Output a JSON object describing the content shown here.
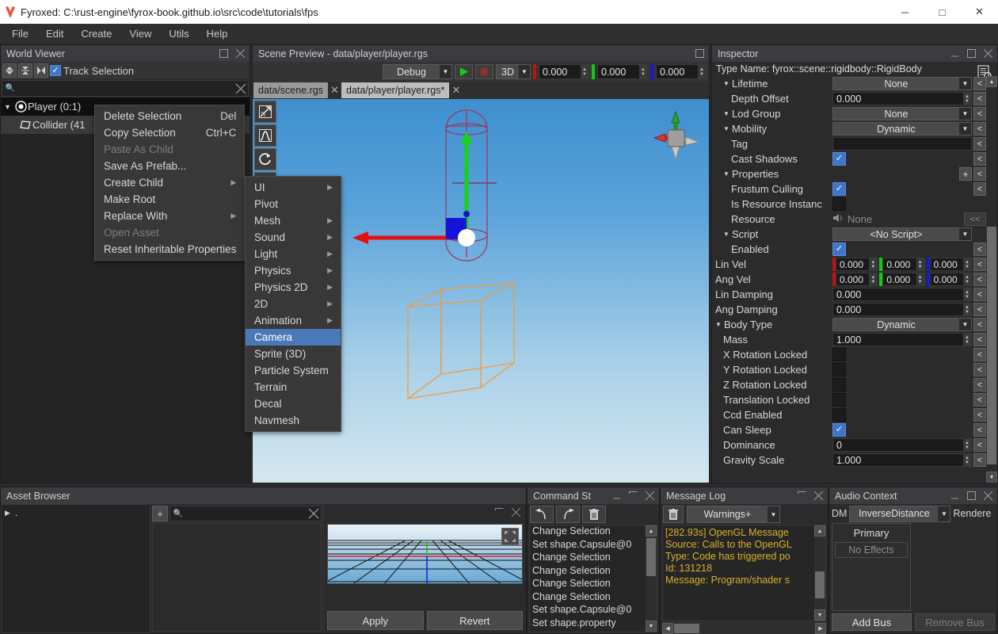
{
  "window": {
    "title": "Fyroxed: C:\\rust-engine\\fyrox-book.github.io\\src\\code\\tutorials\\fps",
    "app_icon": "fyrox-logo-icon",
    "minimize": "─",
    "maximize": "□",
    "close": "✕"
  },
  "menubar": {
    "items": [
      "File",
      "Edit",
      "Create",
      "View",
      "Utils",
      "Help"
    ]
  },
  "world_viewer": {
    "title": "World Viewer",
    "toolbar": {
      "collapse_all_icon": "collapse-all-icon",
      "expand_all_icon": "expand-all-icon",
      "locate_selection_icon": "locate-selection-icon",
      "track_selection_label": "Track Selection",
      "track_selection_checked": true
    },
    "search": {
      "placeholder": "",
      "value": "",
      "icon": "search-icon",
      "clear_icon": "clear-icon"
    },
    "tree": [
      {
        "label": "Player (0:1)",
        "icon": "rigidbody-node-icon",
        "expanded": true,
        "selected": true,
        "depth": 0
      },
      {
        "label": "Collider (41",
        "icon": "collider-node-icon",
        "expanded": false,
        "selected": true,
        "depth": 1
      }
    ]
  },
  "context_menu": {
    "items": [
      {
        "label": "Delete Selection",
        "shortcut": "Del",
        "disabled": false,
        "submenu": false
      },
      {
        "label": "Copy Selection",
        "shortcut": "Ctrl+C",
        "disabled": false,
        "submenu": false
      },
      {
        "label": "Paste As Child",
        "shortcut": "",
        "disabled": true,
        "submenu": false
      },
      {
        "label": "Save As Prefab...",
        "shortcut": "",
        "disabled": false,
        "submenu": false
      },
      {
        "label": "Create Child",
        "shortcut": "",
        "disabled": false,
        "submenu": true
      },
      {
        "label": "Make Root",
        "shortcut": "",
        "disabled": false,
        "submenu": false
      },
      {
        "label": "Replace With",
        "shortcut": "",
        "disabled": false,
        "submenu": true
      },
      {
        "label": "Open Asset",
        "shortcut": "",
        "disabled": true,
        "submenu": false
      },
      {
        "label": "Reset Inheritable Properties",
        "shortcut": "",
        "disabled": false,
        "submenu": false
      }
    ]
  },
  "create_child_submenu": {
    "highlight_color": "#4a79b8",
    "items": [
      {
        "label": "UI",
        "submenu": true,
        "highlighted": false
      },
      {
        "label": "Pivot",
        "submenu": false,
        "highlighted": false
      },
      {
        "label": "Mesh",
        "submenu": true,
        "highlighted": false
      },
      {
        "label": "Sound",
        "submenu": true,
        "highlighted": false
      },
      {
        "label": "Light",
        "submenu": true,
        "highlighted": false
      },
      {
        "label": "Physics",
        "submenu": true,
        "highlighted": false
      },
      {
        "label": "Physics 2D",
        "submenu": true,
        "highlighted": false
      },
      {
        "label": "2D",
        "submenu": true,
        "highlighted": false
      },
      {
        "label": "Animation",
        "submenu": true,
        "highlighted": false
      },
      {
        "label": "Camera",
        "submenu": false,
        "highlighted": true
      },
      {
        "label": "Sprite (3D)",
        "submenu": false,
        "highlighted": false
      },
      {
        "label": "Particle System",
        "submenu": false,
        "highlighted": false
      },
      {
        "label": "Terrain",
        "submenu": false,
        "highlighted": false
      },
      {
        "label": "Decal",
        "submenu": false,
        "highlighted": false
      },
      {
        "label": "Navmesh",
        "submenu": false,
        "highlighted": false
      }
    ]
  },
  "scene_preview": {
    "title": "Scene Preview - data/player/player.rgs",
    "maximize_icon": "maximize-icon",
    "toolbar": {
      "mode_value": "Debug",
      "play_icon": "play-icon",
      "stop_icon": "stop-icon",
      "dimension_value": "3D",
      "x_value": "0.000",
      "y_value": "0.000",
      "z_value": "0.000",
      "x_color": "#c31010",
      "y_color": "#13c913",
      "z_color": "#1818cf"
    },
    "tabs": [
      {
        "label": "data/scene.rgs",
        "active": false
      },
      {
        "label": "data/player/player.rgs*",
        "active": true
      }
    ],
    "viewport_tools": [
      {
        "icon": "move-tool-icon",
        "name": "select-move-tool"
      },
      {
        "icon": "scale-tool-icon",
        "name": "scale-tool"
      },
      {
        "icon": "rotate-tool-icon",
        "name": "rotate-tool"
      },
      {
        "icon": "navmesh-tool-icon",
        "name": "navmesh-tool"
      }
    ],
    "orientation_gizmo": "axis-orientation-gizmo"
  },
  "inspector": {
    "title": "Inspector",
    "minimize_icon": "minimize-icon",
    "maximize_icon": "maximize-icon",
    "close_icon": "close-icon",
    "doc_icon": "documentation-icon",
    "type_name": "Type Name: fyrox::scene::rigidbody::RigidBody",
    "revert_label": "<",
    "revert_wide_label": "<<",
    "add_label": "+",
    "rows": [
      {
        "label": "Lifetime",
        "kind": "dropdown",
        "value": "None",
        "expander": true,
        "indent": 1
      },
      {
        "label": "Depth Offset",
        "kind": "number",
        "value": "0.000",
        "expander": false,
        "indent": 2
      },
      {
        "label": "Lod Group",
        "kind": "dropdown",
        "value": "None",
        "expander": true,
        "indent": 1
      },
      {
        "label": "Mobility",
        "kind": "dropdown",
        "value": "Dynamic",
        "expander": true,
        "indent": 1
      },
      {
        "label": "Tag",
        "kind": "text",
        "value": "",
        "expander": false,
        "indent": 2
      },
      {
        "label": "Cast Shadows",
        "kind": "checkbox",
        "value": true,
        "expander": false,
        "indent": 2
      },
      {
        "label": "Properties",
        "kind": "addrow",
        "value": "",
        "expander": true,
        "indent": 1
      },
      {
        "label": "Frustum Culling",
        "kind": "checkbox",
        "value": true,
        "expander": false,
        "indent": 2
      },
      {
        "label": "Is Resource Instanc",
        "kind": "checkbox",
        "value": false,
        "expander": false,
        "indent": 2,
        "no_revert": true
      },
      {
        "label": "Resource",
        "kind": "resource",
        "value": "None",
        "expander": false,
        "indent": 2
      },
      {
        "label": "Script",
        "kind": "dropdown",
        "value": "<No Script>",
        "expander": true,
        "indent": 1,
        "no_revert": true
      },
      {
        "label": "Enabled",
        "kind": "checkbox",
        "value": true,
        "expander": false,
        "indent": 2
      },
      {
        "label": "Lin Vel",
        "kind": "vec3",
        "value": [
          "0.000",
          "0.000",
          "0.000"
        ],
        "expander": false,
        "indent": 0
      },
      {
        "label": "Ang Vel",
        "kind": "vec3",
        "value": [
          "0.000",
          "0.000",
          "0.000"
        ],
        "expander": false,
        "indent": 0
      },
      {
        "label": "Lin Damping",
        "kind": "number",
        "value": "0.000",
        "expander": false,
        "indent": 0
      },
      {
        "label": "Ang Damping",
        "kind": "number",
        "value": "0.000",
        "expander": false,
        "indent": 0
      },
      {
        "label": "Body Type",
        "kind": "dropdown",
        "value": "Dynamic",
        "expander": true,
        "indent": 0
      },
      {
        "label": "Mass",
        "kind": "number",
        "value": "1.000",
        "expander": false,
        "indent": 1
      },
      {
        "label": "X Rotation Locked",
        "kind": "checkbox",
        "value": false,
        "expander": false,
        "indent": 1
      },
      {
        "label": "Y Rotation Locked",
        "kind": "checkbox",
        "value": false,
        "expander": false,
        "indent": 1
      },
      {
        "label": "Z Rotation Locked",
        "kind": "checkbox",
        "value": false,
        "expander": false,
        "indent": 1
      },
      {
        "label": "Translation Locked",
        "kind": "checkbox",
        "value": false,
        "expander": false,
        "indent": 1
      },
      {
        "label": "Ccd Enabled",
        "kind": "checkbox",
        "value": false,
        "expander": false,
        "indent": 1
      },
      {
        "label": "Can Sleep",
        "kind": "checkbox",
        "value": true,
        "expander": false,
        "indent": 1
      },
      {
        "label": "Dominance",
        "kind": "number",
        "value": "0",
        "expander": false,
        "indent": 1
      },
      {
        "label": "Gravity Scale",
        "kind": "number",
        "value": "1.000",
        "expander": false,
        "indent": 1
      }
    ]
  },
  "asset_browser": {
    "title": "Asset Browser",
    "tree_root": ".",
    "add_label": "+",
    "search": {
      "placeholder": "",
      "value": "",
      "icon": "search-icon",
      "clear_icon": "clear-icon"
    },
    "preview": {
      "maximize_icon": "maximize-icon",
      "close_icon": "close-icon",
      "fit_icon": "fit-to-view-icon",
      "apply_label": "Apply",
      "revert_label": "Revert"
    }
  },
  "command_stack": {
    "title": "Command St",
    "minimize_icon": "minimize-icon",
    "maximize_icon": "maximize-icon",
    "close_icon": "close-icon",
    "undo_icon": "undo-icon",
    "redo_icon": "redo-icon",
    "clear_icon": "trash-icon",
    "items": [
      "Change Selection",
      "Set shape.Capsule@0",
      "Change Selection",
      "Change Selection",
      "Change Selection",
      "Change Selection",
      "Set shape.Capsule@0",
      "Set shape.property"
    ]
  },
  "message_log": {
    "title": "Message Log",
    "maximize_icon": "maximize-icon",
    "close_icon": "close-icon",
    "clear_icon": "trash-icon",
    "filter_value": "Warnings+",
    "text_color": "#d9b12a",
    "lines": [
      "[282.93s] OpenGL Message",
      " Source: Calls to the OpenGL",
      " Type: Code has triggered po",
      " Id: 131218",
      " Message: Program/shader s"
    ]
  },
  "audio_context": {
    "title": "Audio Context",
    "minimize_icon": "minimize-icon",
    "maximize_icon": "maximize-icon",
    "close_icon": "close-icon",
    "dm_label": "DM",
    "dm_value": "InverseDistance",
    "renderer_label": "Rendere",
    "bus_name": "Primary",
    "no_effects_label": "No Effects",
    "add_bus_label": "Add Bus",
    "remove_bus_label": "Remove Bus"
  }
}
